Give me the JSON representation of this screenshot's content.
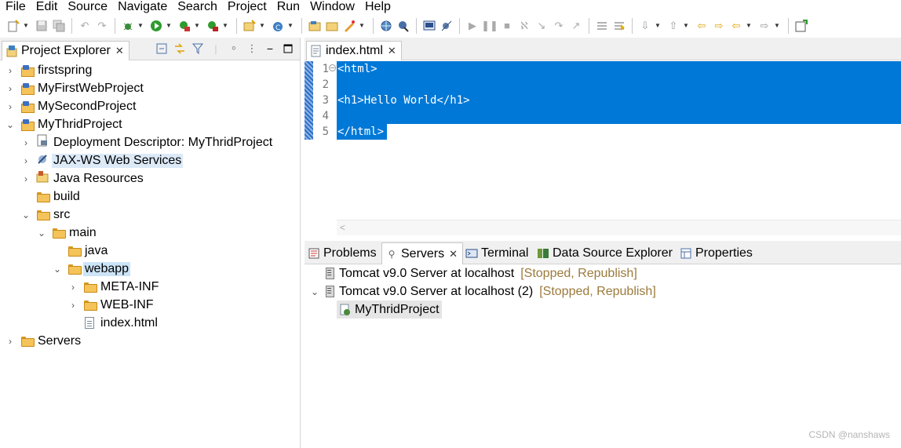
{
  "menubar": [
    "File",
    "Edit",
    "Source",
    "Navigate",
    "Search",
    "Project",
    "Run",
    "Window",
    "Help"
  ],
  "toolbar": {
    "icons": [
      "new-icon",
      "save-icon",
      "save-all-icon",
      "undo-icon",
      "redo-icon",
      "debug-icon",
      "run-icon",
      "coverage-icon",
      "external-tools-icon",
      "new-wizard-icon",
      "new-class-icon",
      "open-type-icon",
      "open-task-icon",
      "globe-icon",
      "open-perspective-icon",
      "console-icon",
      "skip-breakpoints-icon",
      "resume-icon",
      "suspend-icon",
      "terminate-icon",
      "disconnect-icon",
      "step-into-icon",
      "step-over-icon",
      "step-return-icon",
      "toggle-annotation-icon",
      "next-annotation-icon",
      "prev-annotation-icon",
      "last-edit-icon",
      "back-icon",
      "forward-icon",
      "open-perspective-right-icon"
    ]
  },
  "project_explorer": {
    "tab_label": "Project Explorer",
    "tree": [
      {
        "label": "firstspring",
        "icon": "project-icon",
        "twisty": "collapsed"
      },
      {
        "label": "MyFirstWebProject",
        "icon": "project-icon",
        "twisty": "collapsed"
      },
      {
        "label": "MySecondProject",
        "icon": "project-icon",
        "twisty": "collapsed"
      },
      {
        "label": "MyThridProject",
        "icon": "project-icon",
        "twisty": "expanded"
      },
      {
        "label": "Deployment Descriptor: MyThridProject",
        "icon": "descriptor-icon",
        "twisty": "collapsed"
      },
      {
        "label": "JAX-WS Web Services",
        "icon": "webservice-icon",
        "twisty": "collapsed"
      },
      {
        "label": "Java Resources",
        "icon": "java-resources-icon",
        "twisty": "collapsed"
      },
      {
        "label": "build",
        "icon": "folder-icon",
        "twisty": "none"
      },
      {
        "label": "src",
        "icon": "folder-icon",
        "twisty": "expanded"
      },
      {
        "label": "main",
        "icon": "folder-icon",
        "twisty": "expanded"
      },
      {
        "label": "java",
        "icon": "folder-icon",
        "twisty": "none"
      },
      {
        "label": "webapp",
        "icon": "folder-icon",
        "twisty": "expanded"
      },
      {
        "label": "META-INF",
        "icon": "folder-icon",
        "twisty": "collapsed"
      },
      {
        "label": "WEB-INF",
        "icon": "folder-icon",
        "twisty": "collapsed"
      },
      {
        "label": "index.html",
        "icon": "file-icon",
        "twisty": "none"
      },
      {
        "label": "Servers",
        "icon": "folder-icon",
        "twisty": "collapsed"
      }
    ]
  },
  "editor": {
    "tab_label": "index.html",
    "lines": [
      {
        "num": "1",
        "code": "<html>"
      },
      {
        "num": "2",
        "code": ""
      },
      {
        "num": "3",
        "code": "<h1>Hello World</h1>"
      },
      {
        "num": "4",
        "code": ""
      },
      {
        "num": "5",
        "code": "</html>"
      }
    ]
  },
  "bottom_panel": {
    "tabs": [
      "Problems",
      "Servers",
      "Terminal",
      "Data Source Explorer",
      "Properties"
    ],
    "servers": [
      {
        "label": "Tomcat v9.0 Server at localhost",
        "status": "[Stopped, Republish]"
      },
      {
        "label": "Tomcat v9.0 Server at localhost (2)",
        "status": "[Stopped, Republish]"
      },
      {
        "label": "MyThridProject",
        "status": ""
      }
    ]
  },
  "watermark": "CSDN @nanshaws"
}
